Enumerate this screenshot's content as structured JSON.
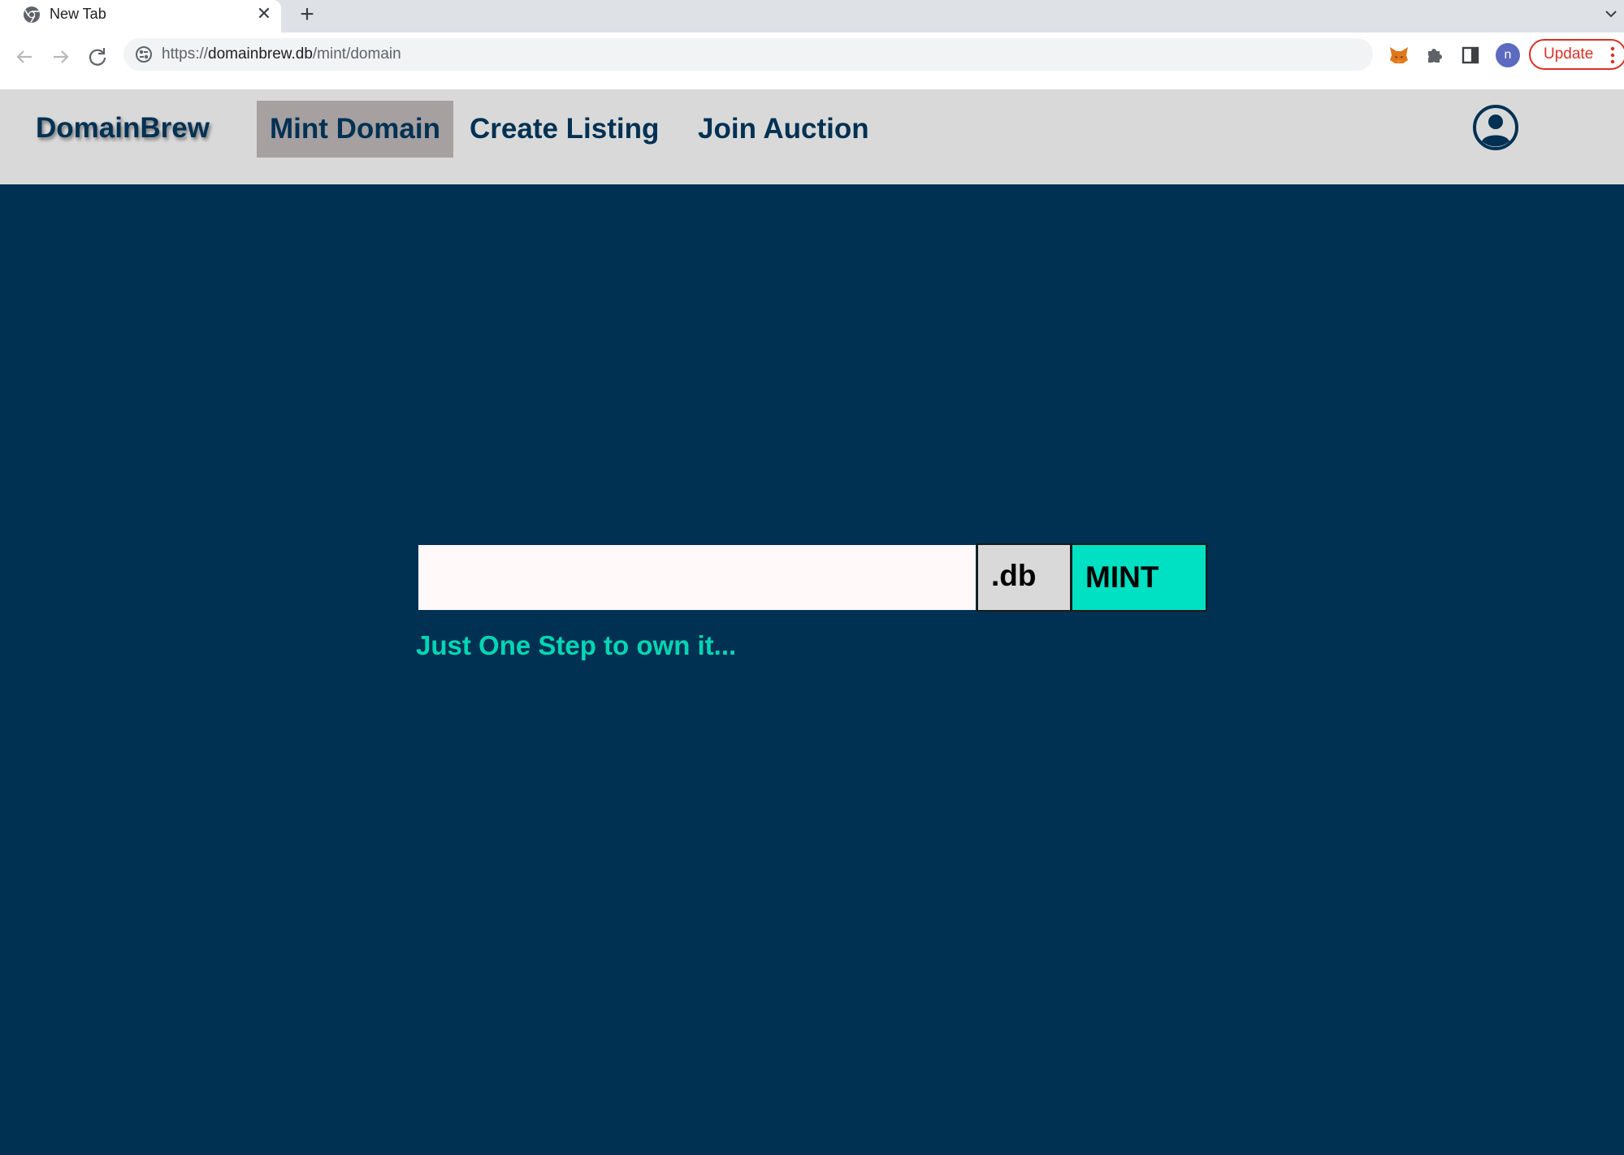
{
  "browser": {
    "tab": {
      "title": "New Tab"
    },
    "url": {
      "scheme": "https://",
      "host": "domainbrew.db",
      "path": "/mint/domain"
    },
    "profile_initial": "n",
    "update_label": "Update"
  },
  "navbar": {
    "brand": "DomainBrew",
    "links": [
      {
        "label": "Mint Domain",
        "active": true
      },
      {
        "label": "Create Listing",
        "active": false
      },
      {
        "label": "Join Auction",
        "active": false
      }
    ]
  },
  "mint": {
    "input_value": "",
    "input_placeholder": "",
    "tld": ".db",
    "button_label": "MINT",
    "tagline": "Just One Step to own it..."
  },
  "colors": {
    "navbar_bg": "#d9d9d9",
    "active_link_bg": "#a6a0a1",
    "brand_text": "#003153",
    "page_bg": "#003152",
    "accent": "#00e0c3",
    "tagline": "#00d6b4"
  },
  "icons": {
    "tab_favicon": "chrome-icon",
    "site_info": "site-info-icon",
    "extensions": [
      "metamask-fox-icon",
      "puzzle-icon",
      "side-panel-icon"
    ],
    "account": "user-circle-icon"
  }
}
